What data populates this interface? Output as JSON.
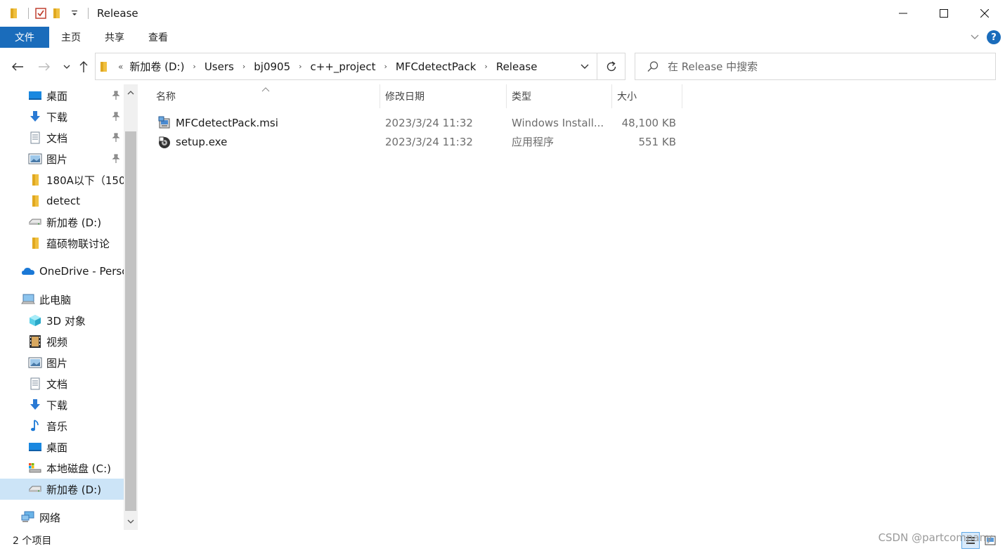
{
  "window": {
    "title": "Release",
    "minimize_glyph": "—",
    "maximize_glyph": "☐",
    "close_glyph": "✕"
  },
  "ribbon": {
    "tabs": [
      {
        "label": "文件"
      },
      {
        "label": "主页"
      },
      {
        "label": "共享"
      },
      {
        "label": "查看"
      }
    ],
    "help": "?"
  },
  "address": {
    "overflow": "«",
    "crumbs": [
      "新加卷 (D:)",
      "Users",
      "bj0905",
      "c++_project",
      "MFCdetectPack",
      "Release"
    ]
  },
  "search": {
    "placeholder": "在 Release 中搜索"
  },
  "sidebar": {
    "items": [
      {
        "label": "桌面",
        "icon": "desktop-icon",
        "pinned": true
      },
      {
        "label": "下载",
        "icon": "download-icon",
        "pinned": true
      },
      {
        "label": "文档",
        "icon": "document-icon",
        "pinned": true
      },
      {
        "label": "图片",
        "icon": "picture-icon",
        "pinned": true
      },
      {
        "label": "180A以下（150",
        "icon": "folder-icon",
        "pinned": false
      },
      {
        "label": "detect",
        "icon": "folder-icon",
        "pinned": false
      },
      {
        "label": "新加卷 (D:)",
        "icon": "drive-icon",
        "pinned": false
      },
      {
        "label": "蕴硕物联讨论",
        "icon": "folder-icon",
        "pinned": false
      },
      {
        "label": "OneDrive - Perso",
        "icon": "onedrive-icon",
        "pinned": false
      },
      {
        "label": "此电脑",
        "icon": "computer-icon",
        "pinned": false
      },
      {
        "label": "3D 对象",
        "icon": "3d-objects-icon",
        "pinned": false
      },
      {
        "label": "视频",
        "icon": "video-icon",
        "pinned": false
      },
      {
        "label": "图片",
        "icon": "picture-icon",
        "pinned": false
      },
      {
        "label": "文档",
        "icon": "document-icon",
        "pinned": false
      },
      {
        "label": "下载",
        "icon": "download-icon",
        "pinned": false
      },
      {
        "label": "音乐",
        "icon": "music-icon",
        "pinned": false
      },
      {
        "label": "桌面",
        "icon": "desktop-icon",
        "pinned": false
      },
      {
        "label": "本地磁盘 (C:)",
        "icon": "system-drive-icon",
        "pinned": false
      },
      {
        "label": "新加卷 (D:)",
        "icon": "drive-icon",
        "pinned": false,
        "selected": true
      },
      {
        "label": "网络",
        "icon": "network-icon",
        "pinned": false
      }
    ]
  },
  "columns": {
    "name": "名称",
    "modified": "修改日期",
    "type": "类型",
    "size": "大小"
  },
  "files": [
    {
      "name": "MFCdetectPack.msi",
      "modified": "2023/3/24 11:32",
      "type": "Windows Install...",
      "size": "48,100 KB",
      "icon": "msi-installer-icon"
    },
    {
      "name": "setup.exe",
      "modified": "2023/3/24 11:32",
      "type": "应用程序",
      "size": "551 KB",
      "icon": "setup-exe-icon"
    }
  ],
  "status": {
    "item_count": "2 个项目"
  },
  "watermark": "CSDN @partcompany"
}
